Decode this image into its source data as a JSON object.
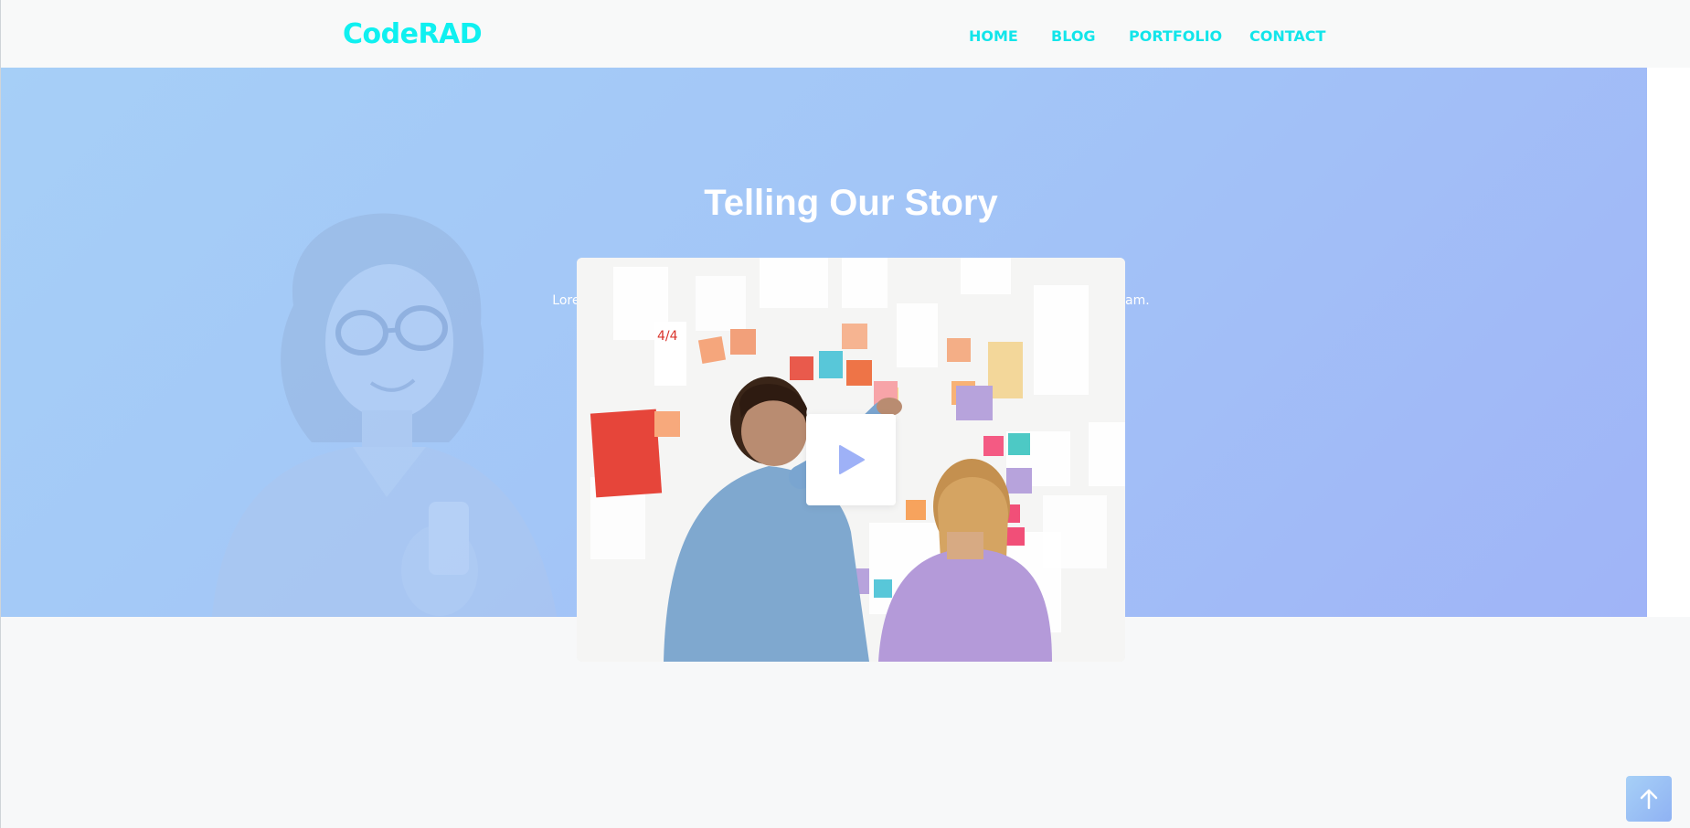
{
  "header": {
    "logo": "CodeRAD",
    "nav": {
      "home": "HOME",
      "blog": "BLOG",
      "portfolio": "PORTFOLIO",
      "contact": "CONTACT"
    }
  },
  "hero": {
    "title": "Telling Our Story",
    "subtitle": "Lorem ipsum dolor sit amet consectetur, adipisicing elit. Illo minima amet autem laboriosam."
  },
  "video": {
    "play_icon": "play-icon"
  },
  "scroll_top": {
    "icon": "arrow-up-icon"
  },
  "colors": {
    "brand": "#0ff0f0",
    "nav": "#12e5ea",
    "hero_start": "#a6cff7",
    "hero_end": "#a0b4f7",
    "play_accent": "#9eb1f7"
  }
}
